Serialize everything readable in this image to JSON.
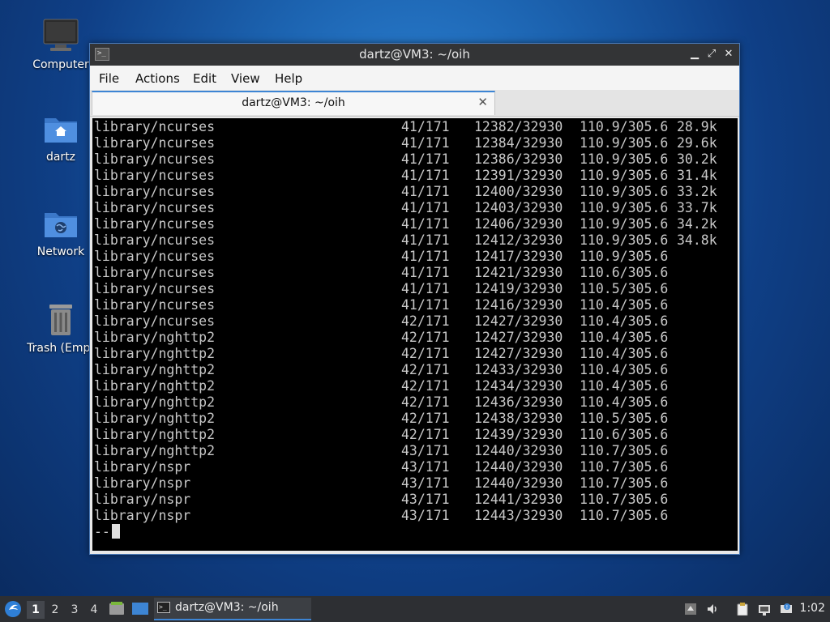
{
  "desktop": {
    "icons": [
      {
        "label": "Computer",
        "icon": "computer-icon"
      },
      {
        "label": "dartz",
        "icon": "home-folder-icon"
      },
      {
        "label": "Network",
        "icon": "network-folder-icon"
      },
      {
        "label": "Trash (Empt",
        "icon": "trash-icon"
      }
    ]
  },
  "window": {
    "title": "dartz@VM3: ~/oih",
    "menus": [
      "File",
      "Actions",
      "Edit",
      "View",
      "Help"
    ],
    "tab_label": "dartz@VM3: ~/oih",
    "tab_close": "✕",
    "controls": {
      "minimize": "▁",
      "maximize": "⤢",
      "close": "✕"
    }
  },
  "terminal": {
    "rows": [
      {
        "name": "library/ncurses",
        "pkgs": "41/171",
        "files": "12382/32930",
        "size": "110.9/305.6",
        "rate": "28.9k"
      },
      {
        "name": "library/ncurses",
        "pkgs": "41/171",
        "files": "12384/32930",
        "size": "110.9/305.6",
        "rate": "29.6k"
      },
      {
        "name": "library/ncurses",
        "pkgs": "41/171",
        "files": "12386/32930",
        "size": "110.9/305.6",
        "rate": "30.2k"
      },
      {
        "name": "library/ncurses",
        "pkgs": "41/171",
        "files": "12391/32930",
        "size": "110.9/305.6",
        "rate": "31.4k"
      },
      {
        "name": "library/ncurses",
        "pkgs": "41/171",
        "files": "12400/32930",
        "size": "110.9/305.6",
        "rate": "33.2k"
      },
      {
        "name": "library/ncurses",
        "pkgs": "41/171",
        "files": "12403/32930",
        "size": "110.9/305.6",
        "rate": "33.7k"
      },
      {
        "name": "library/ncurses",
        "pkgs": "41/171",
        "files": "12406/32930",
        "size": "110.9/305.6",
        "rate": "34.2k"
      },
      {
        "name": "library/ncurses",
        "pkgs": "41/171",
        "files": "12412/32930",
        "size": "110.9/305.6",
        "rate": "34.8k"
      },
      {
        "name": "library/ncurses",
        "pkgs": "41/171",
        "files": "12417/32930",
        "size": "110.9/305.6",
        "rate": ""
      },
      {
        "name": "library/ncurses",
        "pkgs": "41/171",
        "files": "12421/32930",
        "size": "110.6/305.6",
        "rate": ""
      },
      {
        "name": "library/ncurses",
        "pkgs": "41/171",
        "files": "12419/32930",
        "size": "110.5/305.6",
        "rate": ""
      },
      {
        "name": "library/ncurses",
        "pkgs": "41/171",
        "files": "12416/32930",
        "size": "110.4/305.6",
        "rate": ""
      },
      {
        "name": "library/ncurses",
        "pkgs": "42/171",
        "files": "12427/32930",
        "size": "110.4/305.6",
        "rate": ""
      },
      {
        "name": "library/nghttp2",
        "pkgs": "42/171",
        "files": "12427/32930",
        "size": "110.4/305.6",
        "rate": ""
      },
      {
        "name": "library/nghttp2",
        "pkgs": "42/171",
        "files": "12427/32930",
        "size": "110.4/305.6",
        "rate": ""
      },
      {
        "name": "library/nghttp2",
        "pkgs": "42/171",
        "files": "12433/32930",
        "size": "110.4/305.6",
        "rate": ""
      },
      {
        "name": "library/nghttp2",
        "pkgs": "42/171",
        "files": "12434/32930",
        "size": "110.4/305.6",
        "rate": ""
      },
      {
        "name": "library/nghttp2",
        "pkgs": "42/171",
        "files": "12436/32930",
        "size": "110.4/305.6",
        "rate": ""
      },
      {
        "name": "library/nghttp2",
        "pkgs": "42/171",
        "files": "12438/32930",
        "size": "110.5/305.6",
        "rate": ""
      },
      {
        "name": "library/nghttp2",
        "pkgs": "42/171",
        "files": "12439/32930",
        "size": "110.6/305.6",
        "rate": ""
      },
      {
        "name": "library/nghttp2",
        "pkgs": "43/171",
        "files": "12440/32930",
        "size": "110.7/305.6",
        "rate": ""
      },
      {
        "name": "library/nspr",
        "pkgs": "43/171",
        "files": "12440/32930",
        "size": "110.7/305.6",
        "rate": ""
      },
      {
        "name": "library/nspr",
        "pkgs": "43/171",
        "files": "12440/32930",
        "size": "110.7/305.6",
        "rate": ""
      },
      {
        "name": "library/nspr",
        "pkgs": "43/171",
        "files": "12441/32930",
        "size": "110.7/305.6",
        "rate": ""
      },
      {
        "name": "library/nspr",
        "pkgs": "43/171",
        "files": "12443/32930",
        "size": "110.7/305.6",
        "rate": ""
      }
    ],
    "prompt": "--"
  },
  "taskbar": {
    "workspaces": [
      "1",
      "2",
      "3",
      "4"
    ],
    "active_workspace": "1",
    "task_label": "dartz@VM3: ~/oih",
    "clock": "1:02"
  },
  "colors": {
    "accent": "#3d85d4",
    "titlebar": "#333436",
    "terminal_bg": "#000000",
    "terminal_fg": "#c8c8c8",
    "taskbar": "#2d2f33"
  }
}
